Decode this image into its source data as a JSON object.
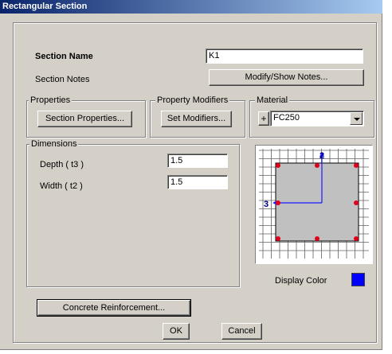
{
  "window": {
    "title": "Rectangular Section"
  },
  "section": {
    "name_label": "Section Name",
    "name_value": "K1",
    "notes_label": "Section Notes",
    "notes_button": "Modify/Show Notes..."
  },
  "properties": {
    "group_label": "Properties",
    "button": "Section Properties..."
  },
  "modifiers": {
    "group_label": "Property Modifiers",
    "button": "Set Modifiers..."
  },
  "material": {
    "group_label": "Material",
    "add_button": "+",
    "selected": "FC250"
  },
  "dimensions": {
    "group_label": "Dimensions",
    "depth_label": "Depth  ( t3 )",
    "depth_value": "1.5",
    "width_label": "Width  ( t2 )",
    "width_value": "1.5"
  },
  "preview": {
    "axis2_label": "2",
    "axis3_label": "3",
    "section_fill": "#c0c0c0",
    "rebar_color": "#e0001a",
    "axis_color": "#1a1aff"
  },
  "display_color": {
    "label": "Display Color",
    "swatch": "#0000ff"
  },
  "buttons": {
    "reinforcement": "Concrete Reinforcement...",
    "ok": "OK",
    "cancel": "Cancel"
  }
}
